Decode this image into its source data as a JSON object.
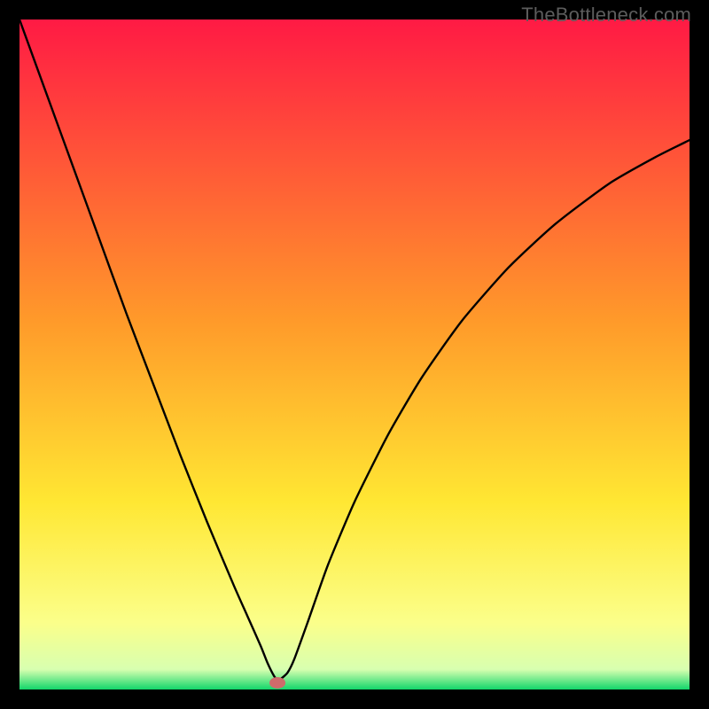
{
  "watermark": "TheBottleneck.com",
  "chart_data": {
    "type": "line",
    "title": "",
    "xlabel": "",
    "ylabel": "",
    "xlim": [
      0,
      100
    ],
    "ylim": [
      0,
      100
    ],
    "grid": false,
    "legend": false,
    "background": {
      "top_color": "#ff1a44",
      "mid_color": "#ffe733",
      "low_color": "#fbff8a",
      "bottom_color": "#12d66a"
    },
    "marker": {
      "x": 38.5,
      "y": 1.0,
      "color": "#cf6b6b"
    },
    "x": [
      0,
      4,
      8,
      12,
      16,
      20,
      24,
      28,
      32,
      34,
      36,
      37,
      38,
      38.5,
      39,
      40,
      41,
      43,
      46,
      50,
      55,
      60,
      66,
      73,
      80,
      88,
      95,
      100
    ],
    "values": [
      100,
      89,
      78,
      67,
      56,
      45.5,
      35,
      25,
      15.5,
      11,
      6.5,
      4,
      2,
      1.5,
      1.6,
      2.5,
      4.5,
      10,
      18.5,
      28,
      38,
      46.5,
      55,
      63,
      69.5,
      75.5,
      79.5,
      82
    ],
    "series": [
      {
        "name": "bottleneck-curve",
        "x": [
          0,
          4,
          8,
          12,
          16,
          20,
          24,
          28,
          32,
          34,
          36,
          37,
          38,
          38.5,
          39,
          40,
          41,
          43,
          46,
          50,
          55,
          60,
          66,
          73,
          80,
          88,
          95,
          100
        ],
        "y": [
          100,
          89,
          78,
          67,
          56,
          45.5,
          35,
          25,
          15.5,
          11,
          6.5,
          4,
          2,
          1.5,
          1.6,
          2.5,
          4.5,
          10,
          18.5,
          28,
          38,
          46.5,
          55,
          63,
          69.5,
          75.5,
          79.5,
          82
        ]
      }
    ]
  }
}
